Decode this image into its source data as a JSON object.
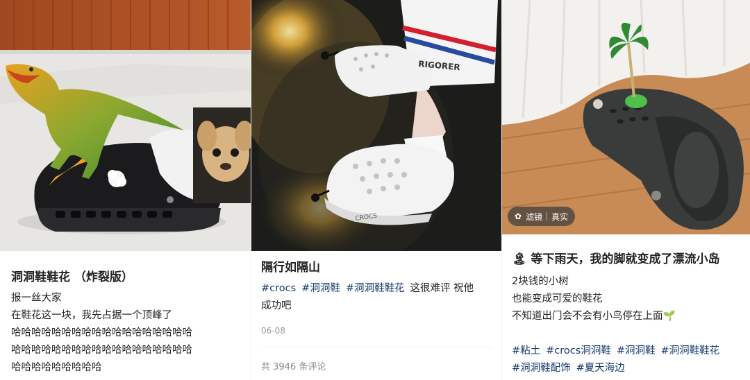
{
  "posts": [
    {
      "title": "洞洞鞋鞋花 （炸裂版）",
      "body": [
        "报一丝大家",
        "在鞋花这一块，我先占据一个顶峰了",
        "哈哈哈哈哈哈哈哈哈哈哈哈哈哈哈哈哈哈",
        "哈哈哈哈哈哈哈哈哈哈哈哈哈哈哈哈哈哈",
        "哈哈哈哈哈哈哈哈哈"
      ]
    },
    {
      "title": "隔行如隔山",
      "tags": [
        "#crocs",
        "#洞洞鞋",
        "#洞洞鞋鞋花"
      ],
      "tail_text": "这很难评 祝他",
      "tail_text_2": "成功吧",
      "date": "06-08",
      "comments": "共 3946 条评论",
      "shoe_brand": "RIGORER",
      "sole_text": "CROCS"
    },
    {
      "title_emoji": "🏝",
      "title": "等下雨天，我的脚就变成了漂流小岛",
      "body": [
        "2块钱的小树",
        "也能变成可爱的鞋花",
        "不知道出门会不会有小鸟停在上面"
      ],
      "body_emoji": "🌱",
      "tags_line1": [
        "#粘土",
        "#crocs洞洞鞋",
        "#洞洞鞋",
        "#洞洞鞋鞋花"
      ],
      "tags_line2": [
        "#洞洞鞋配饰",
        "#夏天海边"
      ],
      "filter_badge": {
        "filter": "滤镜",
        "real": "真实"
      }
    }
  ],
  "colors": {
    "accent": "#ff2442",
    "tag": "#13386c"
  }
}
